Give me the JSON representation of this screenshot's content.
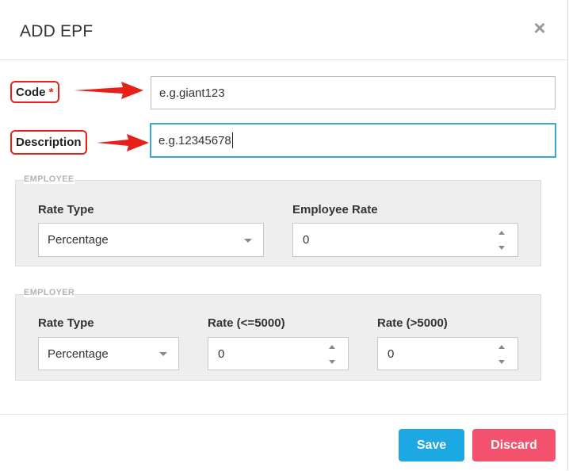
{
  "dialog": {
    "title": "ADD EPF",
    "close_icon": "close-icon"
  },
  "form": {
    "code_label": "Code",
    "required_mark": "*",
    "code_placeholder": "e.g.giant123",
    "description_label": "Description",
    "description_value": "e.g.12345678"
  },
  "employee": {
    "legend": "EMPLOYEE",
    "rate_type_label": "Rate Type",
    "rate_type_value": "Percentage",
    "employee_rate_label": "Employee Rate",
    "employee_rate_value": "0"
  },
  "employer": {
    "legend": "EMPLOYER",
    "rate_type_label": "Rate Type",
    "rate_type_value": "Percentage",
    "rate_low_label": "Rate (<=5000)",
    "rate_low_value": "0",
    "rate_high_label": "Rate (>5000)",
    "rate_high_value": "0"
  },
  "footer": {
    "save_label": "Save",
    "discard_label": "Discard"
  },
  "colors": {
    "annotation": "#e8201a",
    "focus_border": "#39a7d9",
    "save_button": "#1ba8e3",
    "discard_button": "#f3526f"
  },
  "icons": {
    "close": "close-icon",
    "dropdown": "chevron-down-icon",
    "spinner": "spinner-arrows-icon",
    "annotation": "red-arrow-icon"
  }
}
